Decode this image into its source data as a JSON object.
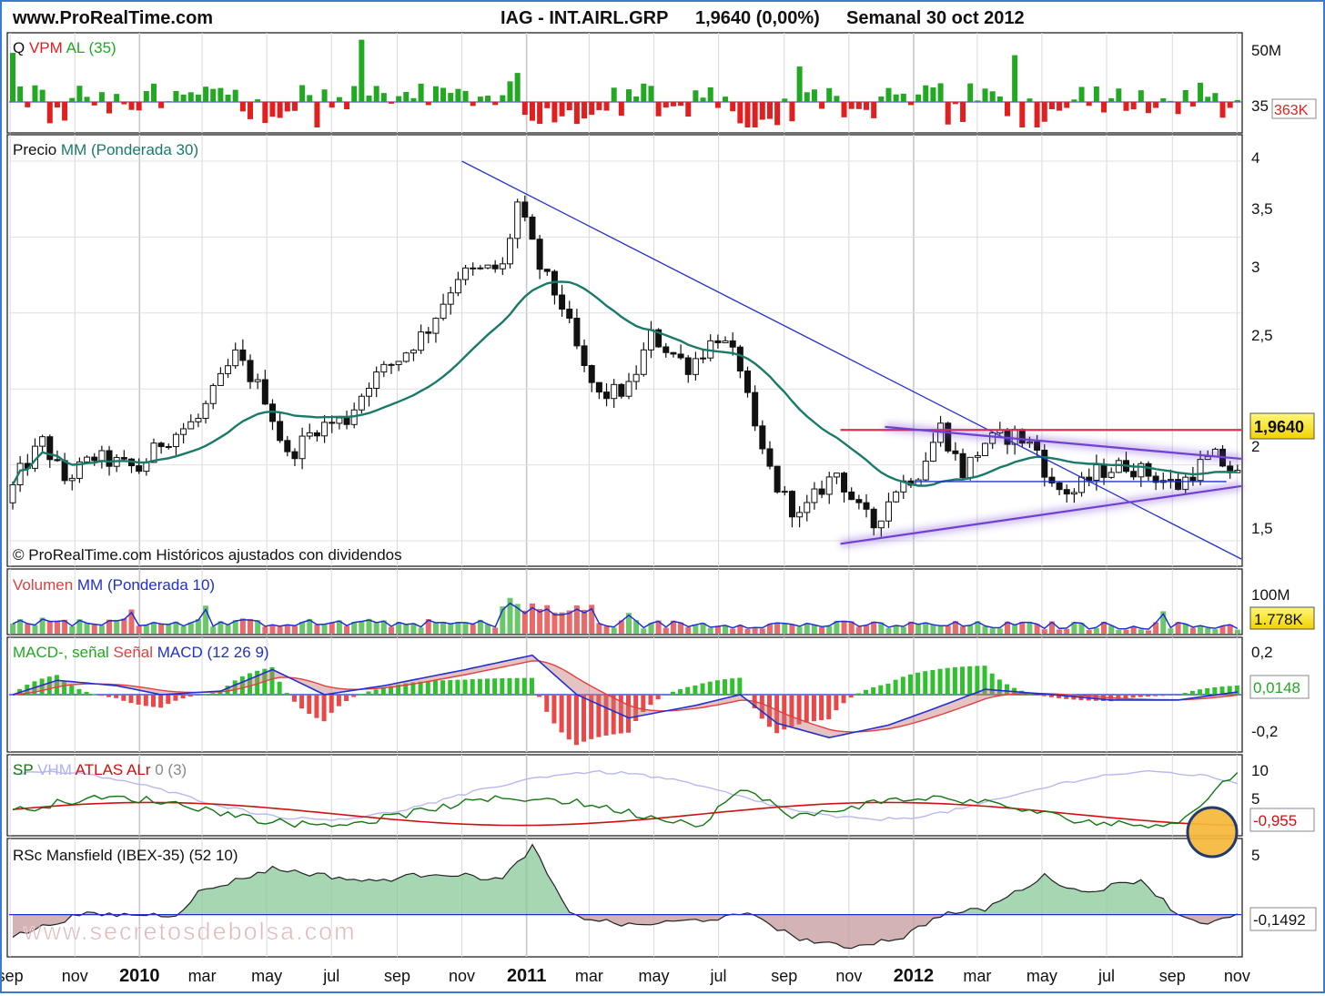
{
  "header": {
    "site": "www.ProRealTime.com",
    "symbol": "IAG - INT.AIRL.GRP",
    "quote": "1,9640 (0,00%)",
    "period": "Semanal  30 oct 2012"
  },
  "watermark": "www.secretosdebolsa.com",
  "colors": {
    "green": "#22a822",
    "red": "#e02020",
    "teal": "#1a7a6a",
    "blue": "#2030d0",
    "purple": "#8050e0",
    "pink": "#e04060",
    "badge": "#ffee44"
  },
  "x_axis": {
    "labels": [
      "sep",
      "nov",
      "2010",
      "mar",
      "may",
      "jul",
      "sep",
      "nov",
      "2011",
      "mar",
      "may",
      "jul",
      "sep",
      "nov",
      "2012",
      "mar",
      "may",
      "jul",
      "sep",
      "nov"
    ],
    "years": [
      "2010",
      "2011",
      "2012"
    ]
  },
  "panels": {
    "q": {
      "legend": [
        {
          "text": "Q ",
          "color": "#111"
        },
        {
          "text": "VPM ",
          "color": "#e02020"
        },
        {
          "text": "AL ",
          "color": "#22a822"
        },
        {
          "text": "(35)",
          "color": "#22a822"
        }
      ],
      "ticks": [
        "50M",
        "35"
      ],
      "badge": "363K"
    },
    "price": {
      "legend": [
        {
          "text": "Precio ",
          "color": "#111"
        },
        {
          "text": "MM ",
          "color": "#1a7a6a"
        },
        {
          "text": "(Ponderada 30)",
          "color": "#1a7a6a"
        }
      ],
      "footer": "© ProRealTime.com  Históricos ajustados con dividendos",
      "ticks": [
        "4",
        "3,5",
        "3",
        "2,5",
        "2",
        "1,5"
      ],
      "badge": "1,9640"
    },
    "volume": {
      "legend": [
        {
          "text": "Volumen ",
          "color": "#e04040"
        },
        {
          "text": "MM ",
          "color": "#2030d0"
        },
        {
          "text": "(Ponderada 10)",
          "color": "#2030d0"
        }
      ],
      "ticks": [
        "100M"
      ],
      "badge": "1.778K"
    },
    "macd": {
      "legend": [
        {
          "text": "MACD-, señal ",
          "color": "#22a822"
        },
        {
          "text": "Señal ",
          "color": "#e04040"
        },
        {
          "text": "MACD ",
          "color": "#2030d0"
        },
        {
          "text": "(12 26 9)",
          "color": "#2030d0"
        }
      ],
      "ticks": [
        "0,2",
        "-0,2"
      ],
      "badge": "0,0148"
    },
    "sp": {
      "legend": [
        {
          "text": "SP ",
          "color": "#117711"
        },
        {
          "text": "VHM ",
          "color": "#b0b0f0"
        },
        {
          "text": "ATLAS ",
          "color": "#d01010"
        },
        {
          "text": "ALr ",
          "color": "#d01010"
        },
        {
          "text": "0 (3)",
          "color": "#888888"
        }
      ],
      "ticks": [
        "10",
        "5"
      ],
      "badge": "-0,955"
    },
    "rsc": {
      "legend": [
        {
          "text": "RSc Mansfield (IBEX-35) (52 10)",
          "color": "#111"
        }
      ],
      "ticks": [
        "5"
      ],
      "badge": "-0,1492"
    }
  },
  "chart_data": {
    "type": "candlestick",
    "frequency": "weekly",
    "price_ylim": [
      1.35,
      4.15
    ],
    "x_range": [
      "2009-08-31",
      "2012-11-05"
    ],
    "last_close": 1.964,
    "price_anchors": [
      [
        "2009-08-31",
        1.75
      ],
      [
        "2009-09-14",
        1.95
      ],
      [
        "2009-10-05",
        2.15
      ],
      [
        "2009-10-26",
        1.9
      ],
      [
        "2009-11-23",
        2.05
      ],
      [
        "2010-01-04",
        1.97
      ],
      [
        "2010-01-25",
        2.15
      ],
      [
        "2010-03-01",
        2.3
      ],
      [
        "2010-04-05",
        2.72
      ],
      [
        "2010-05-03",
        2.45
      ],
      [
        "2010-05-24",
        2.05
      ],
      [
        "2010-06-21",
        2.25
      ],
      [
        "2010-07-19",
        2.3
      ],
      [
        "2010-08-09",
        2.55
      ],
      [
        "2010-09-06",
        2.7
      ],
      [
        "2010-10-04",
        2.9
      ],
      [
        "2010-11-01",
        3.25
      ],
      [
        "2010-12-13",
        3.3
      ],
      [
        "2010-12-27",
        3.72
      ],
      [
        "2011-01-17",
        3.3
      ],
      [
        "2011-02-07",
        3.05
      ],
      [
        "2011-02-28",
        2.62
      ],
      [
        "2011-03-14",
        2.45
      ],
      [
        "2011-04-11",
        2.5
      ],
      [
        "2011-05-02",
        2.85
      ],
      [
        "2011-06-06",
        2.65
      ],
      [
        "2011-07-04",
        2.85
      ],
      [
        "2011-07-25",
        2.65
      ],
      [
        "2011-08-08",
        2.2
      ],
      [
        "2011-08-29",
        1.85
      ],
      [
        "2011-09-19",
        1.65
      ],
      [
        "2011-10-10",
        1.85
      ],
      [
        "2011-10-24",
        1.95
      ],
      [
        "2011-11-14",
        1.7
      ],
      [
        "2011-11-28",
        1.6
      ],
      [
        "2011-12-19",
        1.85
      ],
      [
        "2012-01-09",
        1.95
      ],
      [
        "2012-01-30",
        2.25
      ],
      [
        "2012-02-20",
        1.95
      ],
      [
        "2012-03-12",
        2.15
      ],
      [
        "2012-04-09",
        2.2
      ],
      [
        "2012-04-30",
        2.1
      ],
      [
        "2012-05-14",
        1.85
      ],
      [
        "2012-06-04",
        1.82
      ],
      [
        "2012-06-25",
        1.95
      ],
      [
        "2012-07-23",
        2.0
      ],
      [
        "2012-08-20",
        1.92
      ],
      [
        "2012-09-10",
        1.86
      ],
      [
        "2012-10-01",
        2.0
      ],
      [
        "2012-10-15",
        2.05
      ],
      [
        "2012-10-29",
        1.964
      ]
    ],
    "trendlines": [
      {
        "name": "bajista",
        "color": "#2030d0",
        "from": [
          "2010-11-01",
          4.0
        ],
        "to": [
          "2012-11-05",
          1.38
        ]
      },
      {
        "name": "resistencia",
        "color": "#e03050",
        "from": [
          "2011-10-24",
          2.23
        ],
        "to": [
          "2012-11-05",
          2.23
        ]
      },
      {
        "name": "triangulo-superior",
        "color": "#7040d0",
        "from": [
          "2011-12-05",
          2.25
        ],
        "to": [
          "2012-11-05",
          2.04
        ]
      },
      {
        "name": "triangulo-inferior",
        "color": "#7040d0",
        "from": [
          "2011-10-24",
          1.48
        ],
        "to": [
          "2012-11-05",
          1.86
        ]
      },
      {
        "name": "soporte",
        "color": "#2030d0",
        "from": [
          "2012-01-02",
          1.89
        ],
        "to": [
          "2012-10-22",
          1.89
        ]
      }
    ],
    "moving_average": "Ponderada 30",
    "macd_ylim": [
      -0.3,
      0.3
    ],
    "macd_anchors": [
      [
        "2009-08-31",
        0.0
      ],
      [
        "2009-10-12",
        0.08
      ],
      [
        "2009-12-07",
        0.05
      ],
      [
        "2010-01-18",
        0.0
      ],
      [
        "2010-03-15",
        0.02
      ],
      [
        "2010-05-03",
        0.14
      ],
      [
        "2010-06-21",
        0.0
      ],
      [
        "2010-08-16",
        0.05
      ],
      [
        "2010-11-01",
        0.14
      ],
      [
        "2011-01-03",
        0.22
      ],
      [
        "2011-02-14",
        0.0
      ],
      [
        "2011-04-04",
        -0.13
      ],
      [
        "2011-06-06",
        -0.06
      ],
      [
        "2011-07-18",
        0.0
      ],
      [
        "2011-08-22",
        -0.16
      ],
      [
        "2011-10-10",
        -0.24
      ],
      [
        "2011-12-05",
        -0.17
      ],
      [
        "2012-01-16",
        -0.08
      ],
      [
        "2012-03-05",
        0.03
      ],
      [
        "2012-05-07",
        0.0
      ],
      [
        "2012-07-02",
        -0.03
      ],
      [
        "2012-09-03",
        -0.03
      ],
      [
        "2012-10-29",
        0.0148
      ]
    ],
    "rsc_ylim": [
      -3.5,
      6.5
    ],
    "rsc_anchors": [
      [
        "2009-08-31",
        -2.0
      ],
      [
        "2009-11-02",
        0.0
      ],
      [
        "2010-02-01",
        0.0
      ],
      [
        "2010-02-22",
        2.0
      ],
      [
        "2010-05-03",
        4.2
      ],
      [
        "2010-08-02",
        3.0
      ],
      [
        "2010-10-04",
        3.8
      ],
      [
        "2010-12-06",
        3.2
      ],
      [
        "2011-01-03",
        6.2
      ],
      [
        "2011-02-07",
        0.0
      ],
      [
        "2011-04-04",
        -1.0
      ],
      [
        "2011-06-06",
        -0.5
      ],
      [
        "2011-08-01",
        0.0
      ],
      [
        "2011-09-05",
        -2.0
      ],
      [
        "2011-10-24",
        -3.0
      ],
      [
        "2011-12-19",
        -2.0
      ],
      [
        "2012-01-23",
        0.0
      ],
      [
        "2012-03-05",
        0.5
      ],
      [
        "2012-04-30",
        3.5
      ],
      [
        "2012-06-04",
        2.0
      ],
      [
        "2012-07-30",
        3.2
      ],
      [
        "2012-09-03",
        0.0
      ],
      [
        "2012-10-01",
        -0.8
      ],
      [
        "2012-10-29",
        -0.1492
      ]
    ]
  }
}
